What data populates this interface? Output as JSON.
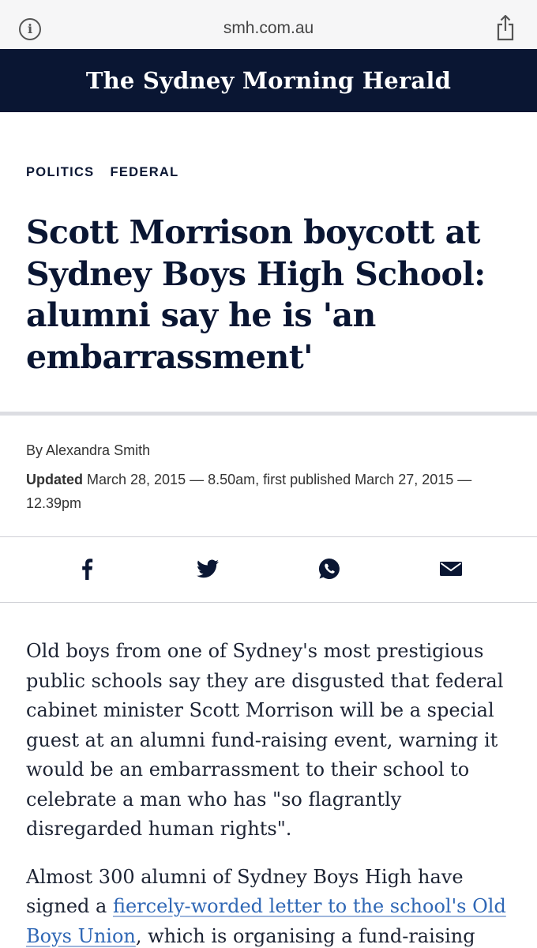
{
  "browser": {
    "url": "smh.com.au",
    "info_glyph": "i"
  },
  "masthead": {
    "logo": "The Sydney Morning Herald"
  },
  "categories": [
    "POLITICS",
    "FEDERAL"
  ],
  "article": {
    "headline": "Scott Morrison boycott at Sydney Boys High School: alumni say he is 'an embarrassment'",
    "byline": "By Alexandra Smith",
    "updated_label": "Updated",
    "dateline": " March 28, 2015 — 8.50am, first published March 27, 2015 — 12.39pm",
    "paragraph1": "Old boys from one of Sydney's most prestigious public schools say they are disgusted that federal cabinet minister Scott Morrison will be a special guest at an alumni fund-raising event, warning it would be an embarrassment to their school to celebrate a man who has \"so flagrantly disregarded human rights\".",
    "paragraph2_before": "Almost 300 alumni of Sydney Boys High have signed a ",
    "paragraph2_link": "fiercely-worded letter to the school's Old Boys Union",
    "paragraph2_after": ", which is organising a fund-raising"
  },
  "share": {
    "icons": [
      "facebook-icon",
      "twitter-icon",
      "whatsapp-icon",
      "email-icon"
    ]
  },
  "colors": {
    "navy": "#0a1633",
    "link": "#2f67b5",
    "browser_bar": "#f6f6f7"
  }
}
